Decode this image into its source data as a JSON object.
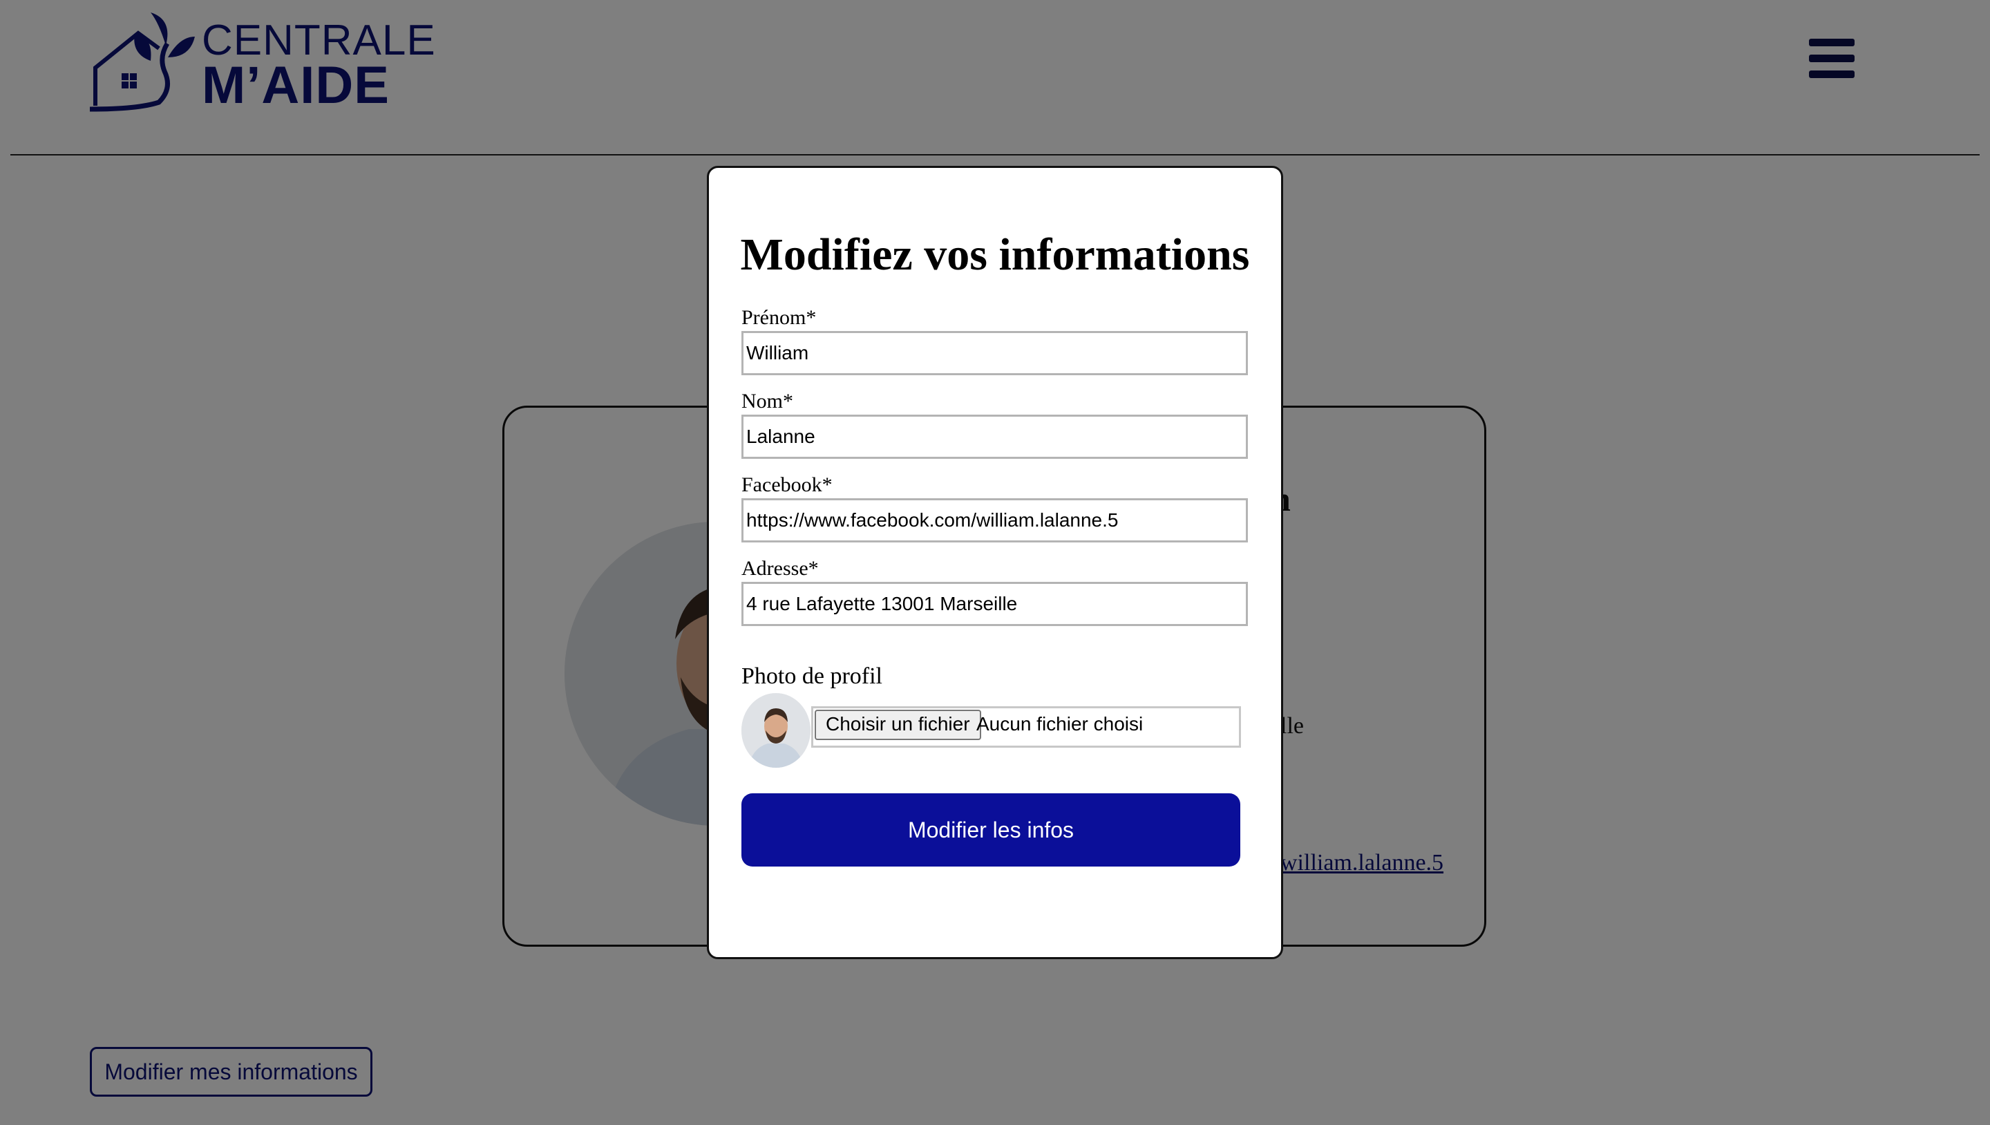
{
  "header": {
    "logo": {
      "line1": "CENTRALE",
      "line2": "M’AIDE"
    },
    "menu_icon": "hamburger-menu-icon"
  },
  "profile": {
    "name_partial": "n",
    "city_partial": "lle",
    "facebook_partial": "william.lalanne.5"
  },
  "page_actions": {
    "edit_info_label": "Modifier mes informations"
  },
  "modal": {
    "title": "Modifiez vos informations",
    "fields": [
      {
        "label": "Prénom*",
        "value": "William"
      },
      {
        "label": "Nom*",
        "value": "Lalanne"
      },
      {
        "label": "Facebook*",
        "value": "https://www.facebook.com/william.lalanne.5"
      },
      {
        "label": "Adresse*",
        "value": "4 rue Lafayette 13001 Marseille"
      }
    ],
    "photo": {
      "label": "Photo de profil",
      "choose_label": "Choisir un fichier",
      "status": "Aucun fichier choisi"
    },
    "submit_label": "Modifier les infos"
  },
  "colors": {
    "brand": "#0d1275",
    "primary_button": "#0b0f99",
    "overlay": "rgba(0,0,0,0.5)"
  }
}
